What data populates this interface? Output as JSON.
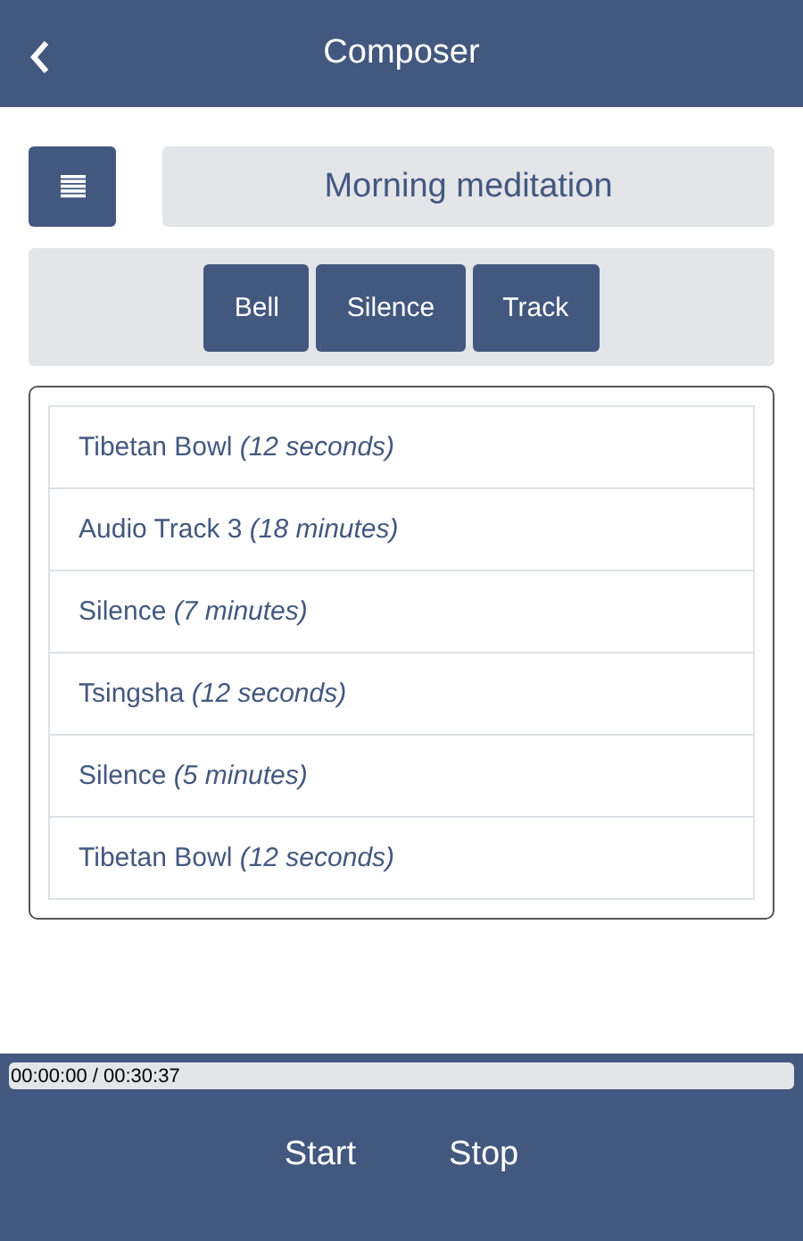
{
  "header": {
    "title": "Composer"
  },
  "composition": {
    "name": "Morning meditation"
  },
  "add_buttons": [
    "Bell",
    "Silence",
    "Track"
  ],
  "items": [
    {
      "text": "Tibetan Bowl *(12 seconds)*"
    },
    {
      "text": "Audio Track 3 *(18 minutes)*"
    },
    {
      "text": "Silence *(7 minutes)*"
    },
    {
      "text": "Tsingsha *(12 seconds)*"
    },
    {
      "text": "Silence *(5 minutes)*"
    },
    {
      "text": "Tibetan Bowl *(12 seconds)*"
    }
  ],
  "progress": {
    "reading": "00:00:00 / 00:30:37",
    "level": 0
  },
  "controls": [
    "Start",
    "Stop"
  ]
}
